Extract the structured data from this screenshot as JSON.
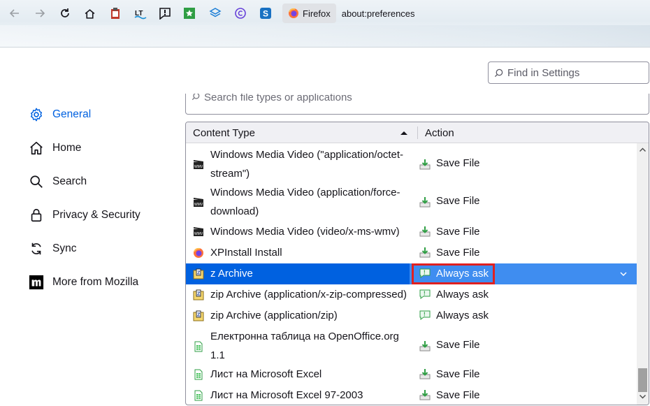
{
  "toolbar": {
    "identity_label": "Firefox",
    "url": "about:preferences"
  },
  "search": {
    "placeholder": "Find in Settings"
  },
  "sidebar": {
    "items": [
      {
        "label": "General",
        "icon": "gear-icon",
        "selected": true
      },
      {
        "label": "Home",
        "icon": "home-icon"
      },
      {
        "label": "Search",
        "icon": "search-icon"
      },
      {
        "label": "Privacy & Security",
        "icon": "lock-icon"
      },
      {
        "label": "Sync",
        "icon": "sync-icon"
      },
      {
        "label": "More from Mozilla",
        "icon": "mozilla-icon"
      }
    ]
  },
  "filetypes": {
    "search_placeholder": "Search file types or applications",
    "header_type": "Content Type",
    "header_action": "Action",
    "rows": [
      {
        "type": "Windows Media Video (\"application/octet-stream\")",
        "action": "Save File",
        "type_icon": "video-icon",
        "action_icon": "save-file-icon"
      },
      {
        "type": "Windows Media Video (application/force-download)",
        "action": "Save File",
        "type_icon": "video-icon",
        "action_icon": "save-file-icon"
      },
      {
        "type": "Windows Media Video (video/x-ms-wmv)",
        "action": "Save File",
        "type_icon": "video-icon",
        "action_icon": "save-file-icon"
      },
      {
        "type": "XPInstall Install",
        "action": "Save File",
        "type_icon": "firefox-icon",
        "action_icon": "save-file-icon"
      },
      {
        "type": "z Archive",
        "action": "Always ask",
        "type_icon": "archive-icon",
        "action_icon": "always-ask-icon",
        "selected": true
      },
      {
        "type": "zip Archive (application/x-zip-compressed)",
        "action": "Always ask",
        "type_icon": "archive-icon",
        "action_icon": "always-ask-icon"
      },
      {
        "type": "zip Archive (application/zip)",
        "action": "Always ask",
        "type_icon": "archive-icon",
        "action_icon": "always-ask-icon"
      },
      {
        "type": "Електронна таблица на OpenOffice.org 1.1",
        "action": "Save File",
        "type_icon": "spreadsheet-icon",
        "action_icon": "save-file-icon"
      },
      {
        "type": "Лист на Microsoft Excel",
        "action": "Save File",
        "type_icon": "spreadsheet-icon",
        "action_icon": "save-file-icon"
      },
      {
        "type": "Лист на Microsoft Excel 97-2003",
        "action": "Save File",
        "type_icon": "spreadsheet-icon",
        "action_icon": "save-file-icon"
      }
    ]
  },
  "colors": {
    "accent": "#0061e0",
    "highlight": "#e02020"
  }
}
